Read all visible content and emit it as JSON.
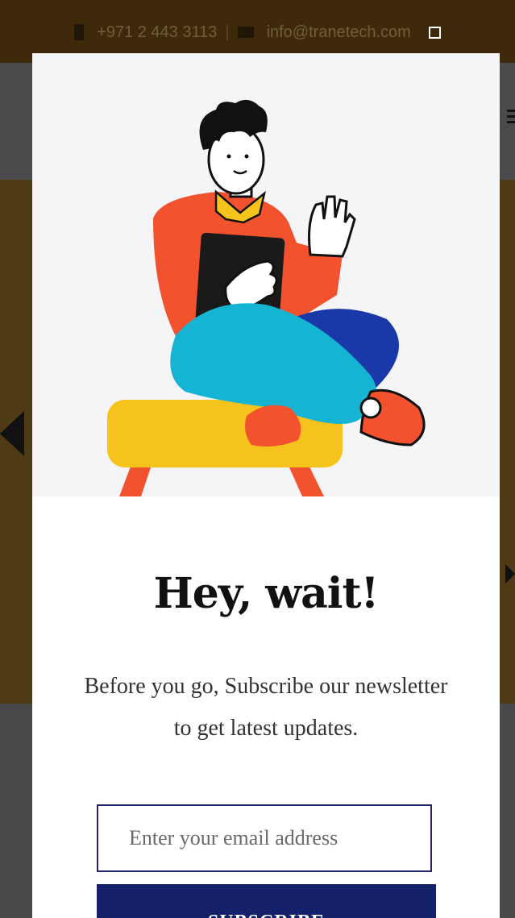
{
  "topbar": {
    "phone": "+971 2 443 3113",
    "separator": "|",
    "email": "info@tranetech.com",
    "icons": [
      "phone-icon",
      "envelope-icon",
      "square-icon"
    ]
  },
  "popup": {
    "title": "Hey, wait!",
    "description": "Before you go, Subscribe our newsletter to get latest updates.",
    "email_placeholder": "Enter your email address",
    "subscribe_label": "SUBSCRIBE"
  },
  "colors": {
    "topbar_bg": "#3e2a0a",
    "button_bg": "#15206b",
    "input_border": "#1e2466",
    "shirt": "#f2522e",
    "pants_light": "#14b4d2",
    "pants_dark": "#1a38a8",
    "stool": "#f6c21c"
  }
}
